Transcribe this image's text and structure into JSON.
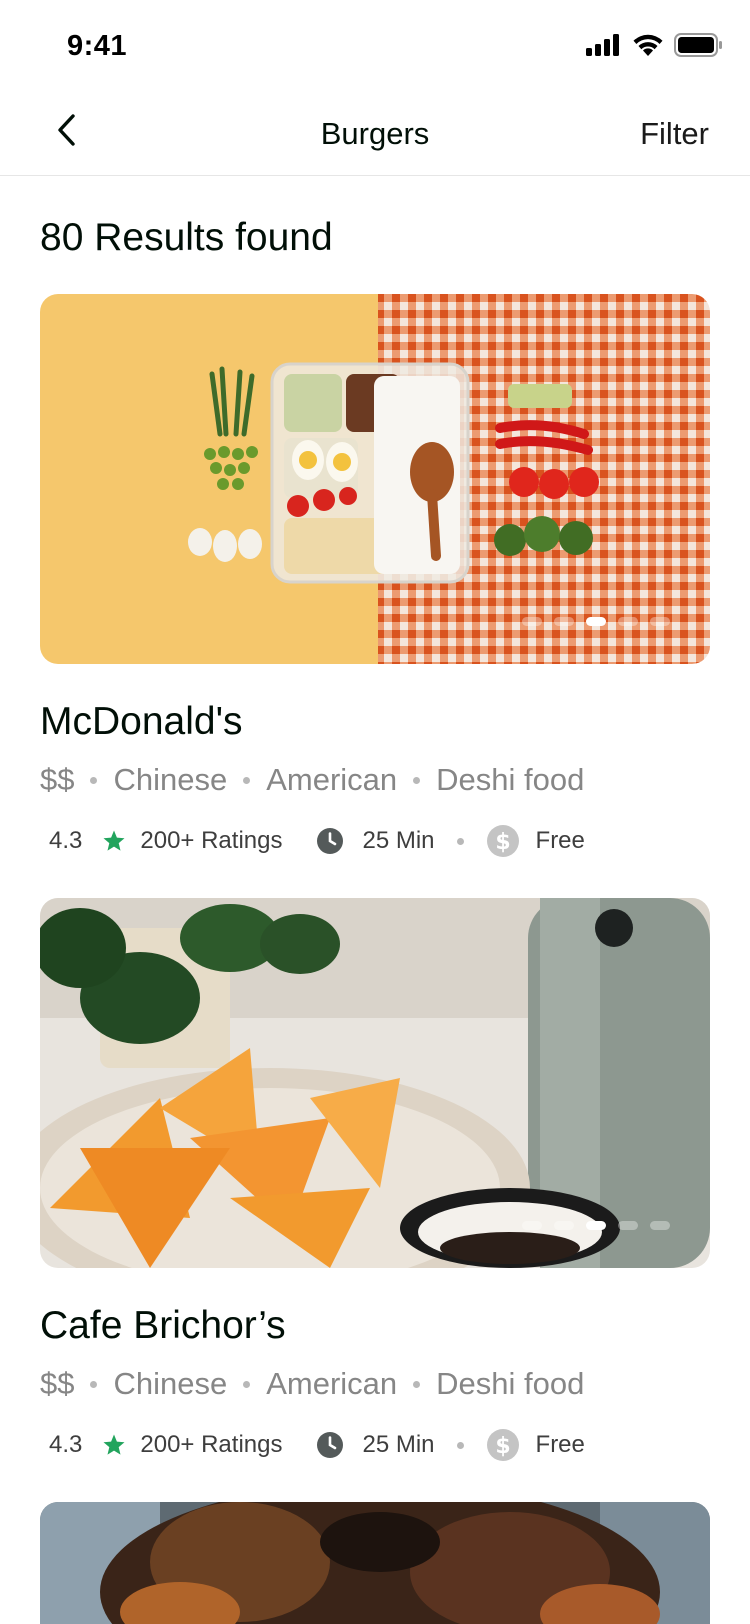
{
  "status_bar": {
    "time": "9:41"
  },
  "nav": {
    "title": "Burgers",
    "filter_label": "Filter",
    "back_icon": "chevron-left-icon"
  },
  "results": {
    "heading": "80 Results found"
  },
  "colors": {
    "star": "#22a45d",
    "icon_dark": "#545a5a",
    "tag_text": "#868686"
  },
  "restaurants": [
    {
      "name": "McDonald's",
      "price": "$$",
      "cuisines": [
        "Chinese",
        "American",
        "Deshi food"
      ],
      "rating": "4.3",
      "ratings_count": "200+ Ratings",
      "delivery_time": "25 Min",
      "delivery_fee": "Free",
      "carousel": {
        "total": 5,
        "active_index": 2
      }
    },
    {
      "name": "Cafe Brichor’s",
      "price": "$$",
      "cuisines": [
        "Chinese",
        "American",
        "Deshi food"
      ],
      "rating": "4.3",
      "ratings_count": "200+ Ratings",
      "delivery_time": "25 Min",
      "delivery_fee": "Free",
      "carousel": {
        "total": 5,
        "active_index": 2
      }
    }
  ]
}
